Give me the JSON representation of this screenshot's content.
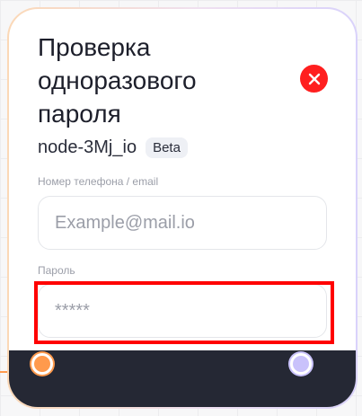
{
  "node": {
    "title": "Проверка одноразового пароля",
    "node_id": "node-3Mj_io",
    "badge": "Beta",
    "close_icon": "close-icon"
  },
  "fields": {
    "email": {
      "label": "Номер телефона / email",
      "placeholder": "Example@mail.io",
      "value": ""
    },
    "password": {
      "label": "Пароль",
      "placeholder": "*****",
      "value": ""
    }
  },
  "colors": {
    "close_button": "#ff1f1f",
    "footer": "#252834",
    "port_left": "#ff9a4d",
    "port_right": "#c9c2fb",
    "highlight": "#ff0000"
  }
}
